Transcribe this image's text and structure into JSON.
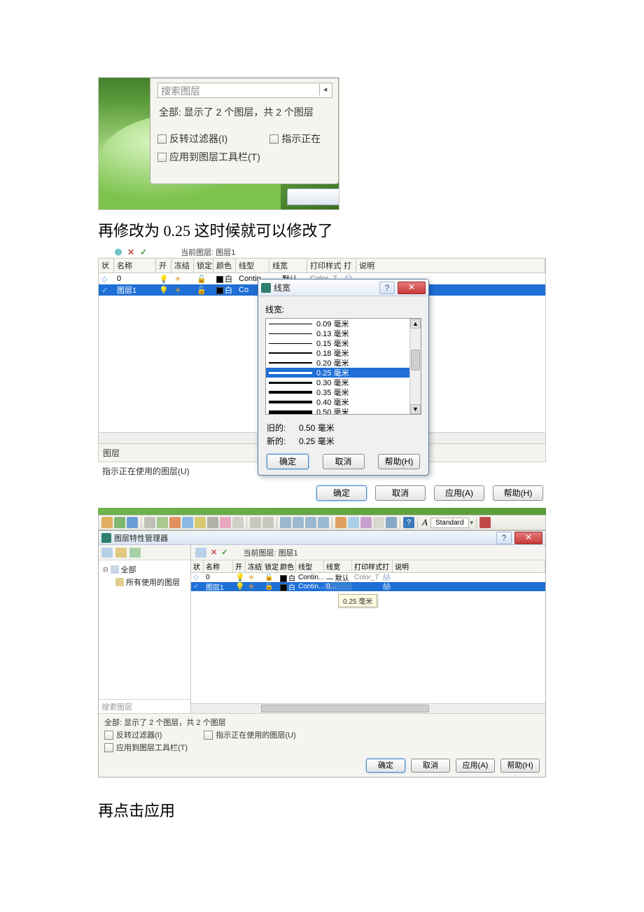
{
  "doc": {
    "text1": "再修改为 0.25    这时候就可以修改了",
    "text2": "再点击应用"
  },
  "shot1": {
    "search_placeholder": "搜索图层",
    "status": "全部: 显示了 2 个图层，共 2 个图层",
    "invert_filter": "反转过滤器(I)",
    "indicate_in_use": "指示正在",
    "apply_to_toolbar": "应用到图层工具栏(T)"
  },
  "shot2": {
    "current_layer_prefix": "当前图层: ",
    "current_layer": "图层1",
    "headers": {
      "status": "状",
      "name": "名称",
      "on": "开",
      "freeze": "冻结",
      "lock": "锁定",
      "color": "颜色",
      "linetype": "线型",
      "lineweight": "线宽",
      "plotstyle": "打印样式",
      "plot": "打",
      "desc": "说明"
    },
    "rows": [
      {
        "name": "0",
        "color_label": "白",
        "linetype": "Contin…",
        "lineweight": "— 默认",
        "plotstyle": "Color_7"
      },
      {
        "name": "图层1",
        "color_label": "白",
        "linetype": "Co",
        "lineweight": "",
        "plotstyle": ""
      }
    ],
    "footer_section": "图层",
    "footer_indicate": "指示正在使用的图层(U)",
    "buttons": {
      "ok": "确定",
      "cancel": "取消",
      "apply": "应用(A)",
      "help": "帮助(H)"
    },
    "lineweight_dialog": {
      "title": "线宽",
      "label": "线宽:",
      "items": [
        {
          "label": "0.09 毫米",
          "h": 1
        },
        {
          "label": "0.13 毫米",
          "h": 1
        },
        {
          "label": "0.15 毫米",
          "h": 1
        },
        {
          "label": "0.18 毫米",
          "h": 2
        },
        {
          "label": "0.20 毫米",
          "h": 2
        },
        {
          "label": "0.25 毫米",
          "h": 3,
          "selected": true
        },
        {
          "label": "0.30 毫米",
          "h": 3
        },
        {
          "label": "0.35 毫米",
          "h": 4
        },
        {
          "label": "0.40 毫米",
          "h": 4
        },
        {
          "label": "0.50 毫米",
          "h": 5
        }
      ],
      "old_label": "旧的:",
      "old_value": "0.50 毫米",
      "new_label": "新的:",
      "new_value": "0.25 毫米",
      "ok": "确定",
      "cancel": "取消",
      "help": "帮助(H)"
    }
  },
  "shot3": {
    "title": "图层特性管理器",
    "toolbar_text": "Standard",
    "current_layer_prefix": "当前图层: ",
    "current_layer": "图层1",
    "tree": {
      "all": "全部",
      "all_used": "所有使用的图层"
    },
    "search_placeholder": "搜索图层",
    "headers": {
      "status": "状",
      "name": "名称",
      "on": "开",
      "freeze": "冻结",
      "lock": "锁定",
      "color": "颜色",
      "linetype": "线型",
      "lineweight": "线宽",
      "plotstyle": "打印样式",
      "plot": "打",
      "desc": "说明"
    },
    "rows": [
      {
        "name": "0",
        "color_label": "白",
        "linetype": "Contin…",
        "lineweight": "— 默认",
        "plotstyle": "Color_7"
      },
      {
        "name": "图层1",
        "color_label": "白",
        "linetype": "Contin…",
        "lineweight": "0…",
        "plotstyle": ""
      }
    ],
    "tooltip": "0.25 毫米",
    "footer_status": "全部: 显示了 2 个图层，共 2 个图层",
    "invert_filter": "反转过滤器(I)",
    "indicate_in_use": "指示正在使用的图层(U)",
    "apply_to_toolbar": "应用到图层工具栏(T)",
    "buttons": {
      "ok": "确定",
      "cancel": "取消",
      "apply": "应用(A)",
      "help": "帮助(H)"
    }
  }
}
